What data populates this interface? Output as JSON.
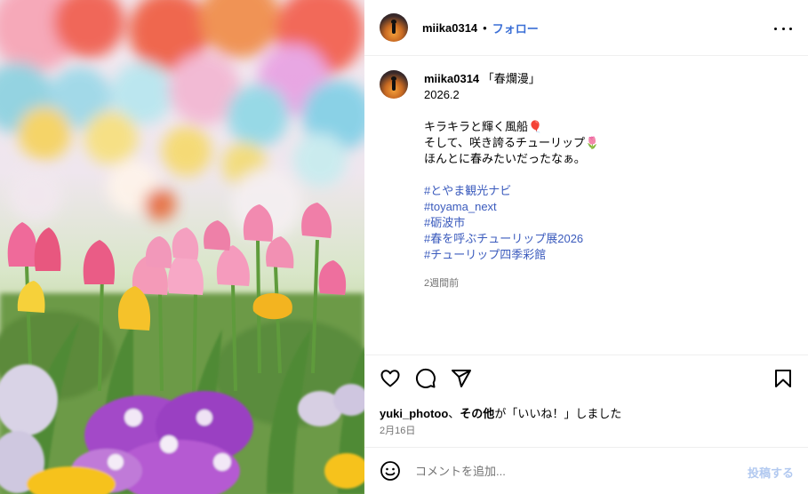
{
  "post": {
    "username": "miika0314",
    "separator": "•",
    "follow_label": "フォロー",
    "more_icon": "more-horizontal-icon"
  },
  "caption": {
    "username": "miika0314",
    "lines": [
      " 「春爛漫」",
      "2026.2",
      "",
      "キラキラと輝く風船🎈",
      "そして、咲き誇るチューリップ🌷",
      "ほんとに春みたいだったなぁ。",
      ""
    ],
    "hashtags": [
      "#とやま観光ナビ",
      "#toyama_next",
      "#砺波市",
      "#春を呼ぶチューリップ展2026",
      "#チューリップ四季彩館"
    ],
    "time_ago": "2週間前"
  },
  "actions": {
    "like_icon": "heart-icon",
    "comment_icon": "comment-icon",
    "share_icon": "send-icon",
    "save_icon": "bookmark-icon"
  },
  "likes": {
    "user": "yuki_photoo",
    "connector": "、",
    "others": "その他",
    "suffix": "が「いいね！」しました"
  },
  "date": "2月16日",
  "comment": {
    "emoji_icon": "smiley-icon",
    "placeholder": "コメントを追加...",
    "submit_label": "投稿する"
  },
  "colors": {
    "accent": "#3b6fd6",
    "hashtag": "#3b5bbd",
    "muted": "#737373",
    "submit_disabled": "#b2c9f0"
  }
}
